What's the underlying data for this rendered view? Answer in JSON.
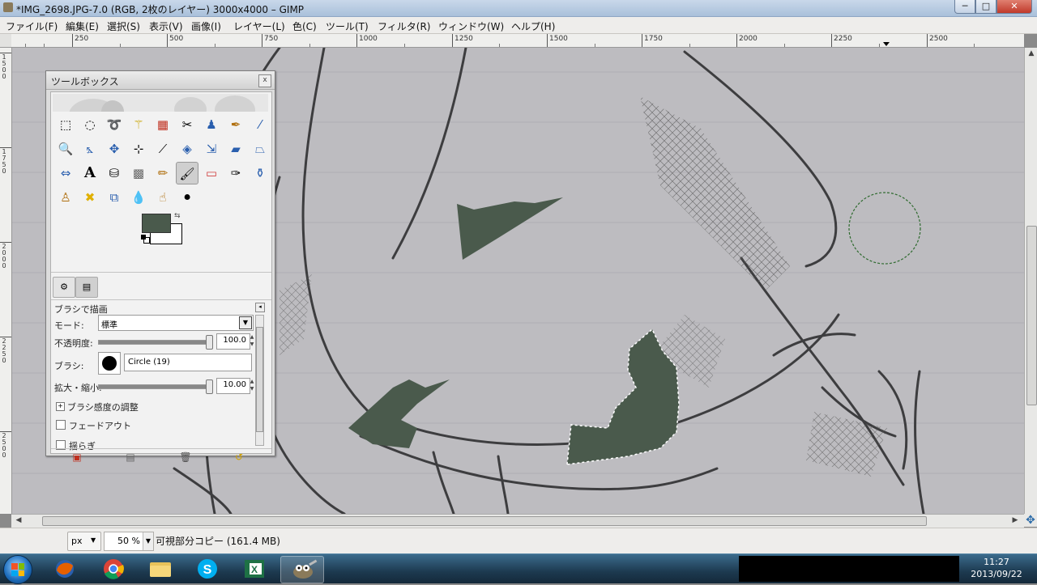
{
  "window": {
    "title": "*IMG_2698.JPG-7.0 (RGB, 2枚のレイヤー) 3000x4000 – GIMP",
    "minimize": "─",
    "maximize": "□",
    "close": "✕"
  },
  "menu": [
    "ファイル(F)",
    "編集(E)",
    "選択(S)",
    "表示(V)",
    "画像(I)",
    "レイヤー(L)",
    "色(C)",
    "ツール(T)",
    "フィルタ(R)",
    "ウィンドウ(W)",
    "ヘルプ(H)"
  ],
  "ruler": {
    "h_labels": [
      "250",
      "500",
      "750",
      "1000",
      "1250",
      "1500",
      "1750",
      "2000",
      "2250",
      "2500"
    ],
    "v_labels": [
      "1\n5\n0\n0",
      "1\n7\n5\n0",
      "2\n0\n0\n0",
      "2\n2\n5\n0",
      "2\n5\n0\n0"
    ]
  },
  "toolbox": {
    "title": "ツールボックス",
    "close": "x",
    "fg_color": "#4a5a4c",
    "bg_color": "#ffffff",
    "tool_options": {
      "title": "ブラシで描画",
      "mode_label": "モード:",
      "mode_value": "標準",
      "opacity_label": "不透明度:",
      "opacity_value": "100.0",
      "opacity_fraction": 1.0,
      "brush_label": "ブラシ:",
      "brush_name": "Circle (19)",
      "scale_label": "拡大・縮小:",
      "scale_value": "10.00",
      "scale_fraction": 1.0,
      "dynamics_label": "ブラシ感度の調整",
      "fade_label": "フェードアウト",
      "jitter_label": "揺らぎ"
    }
  },
  "status": {
    "unit": "px",
    "zoom": "50 %",
    "message": "可視部分コピー (161.4 MB)"
  },
  "taskbar": {
    "time": "11:27",
    "date": "2013/09/22"
  },
  "colors": {
    "fill": "#4a5a4c",
    "paper": "#bdbcc0",
    "titlebar": "#c9d8ea"
  }
}
